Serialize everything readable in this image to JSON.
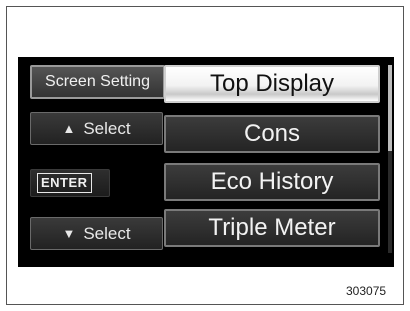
{
  "left_panel": {
    "screen_setting_label": "Screen Setting",
    "select_up_label": "Select",
    "select_up_icon": "triangle-up-icon",
    "enter_label": "ENTER",
    "select_down_label": "Select",
    "select_down_icon": "triangle-down-icon"
  },
  "menu": {
    "items": [
      {
        "label": "Top Display",
        "selected": true
      },
      {
        "label": "Cons",
        "selected": false
      },
      {
        "label": "Eco History",
        "selected": false
      },
      {
        "label": "Triple Meter",
        "selected": false
      }
    ]
  },
  "figure_code": "303075"
}
